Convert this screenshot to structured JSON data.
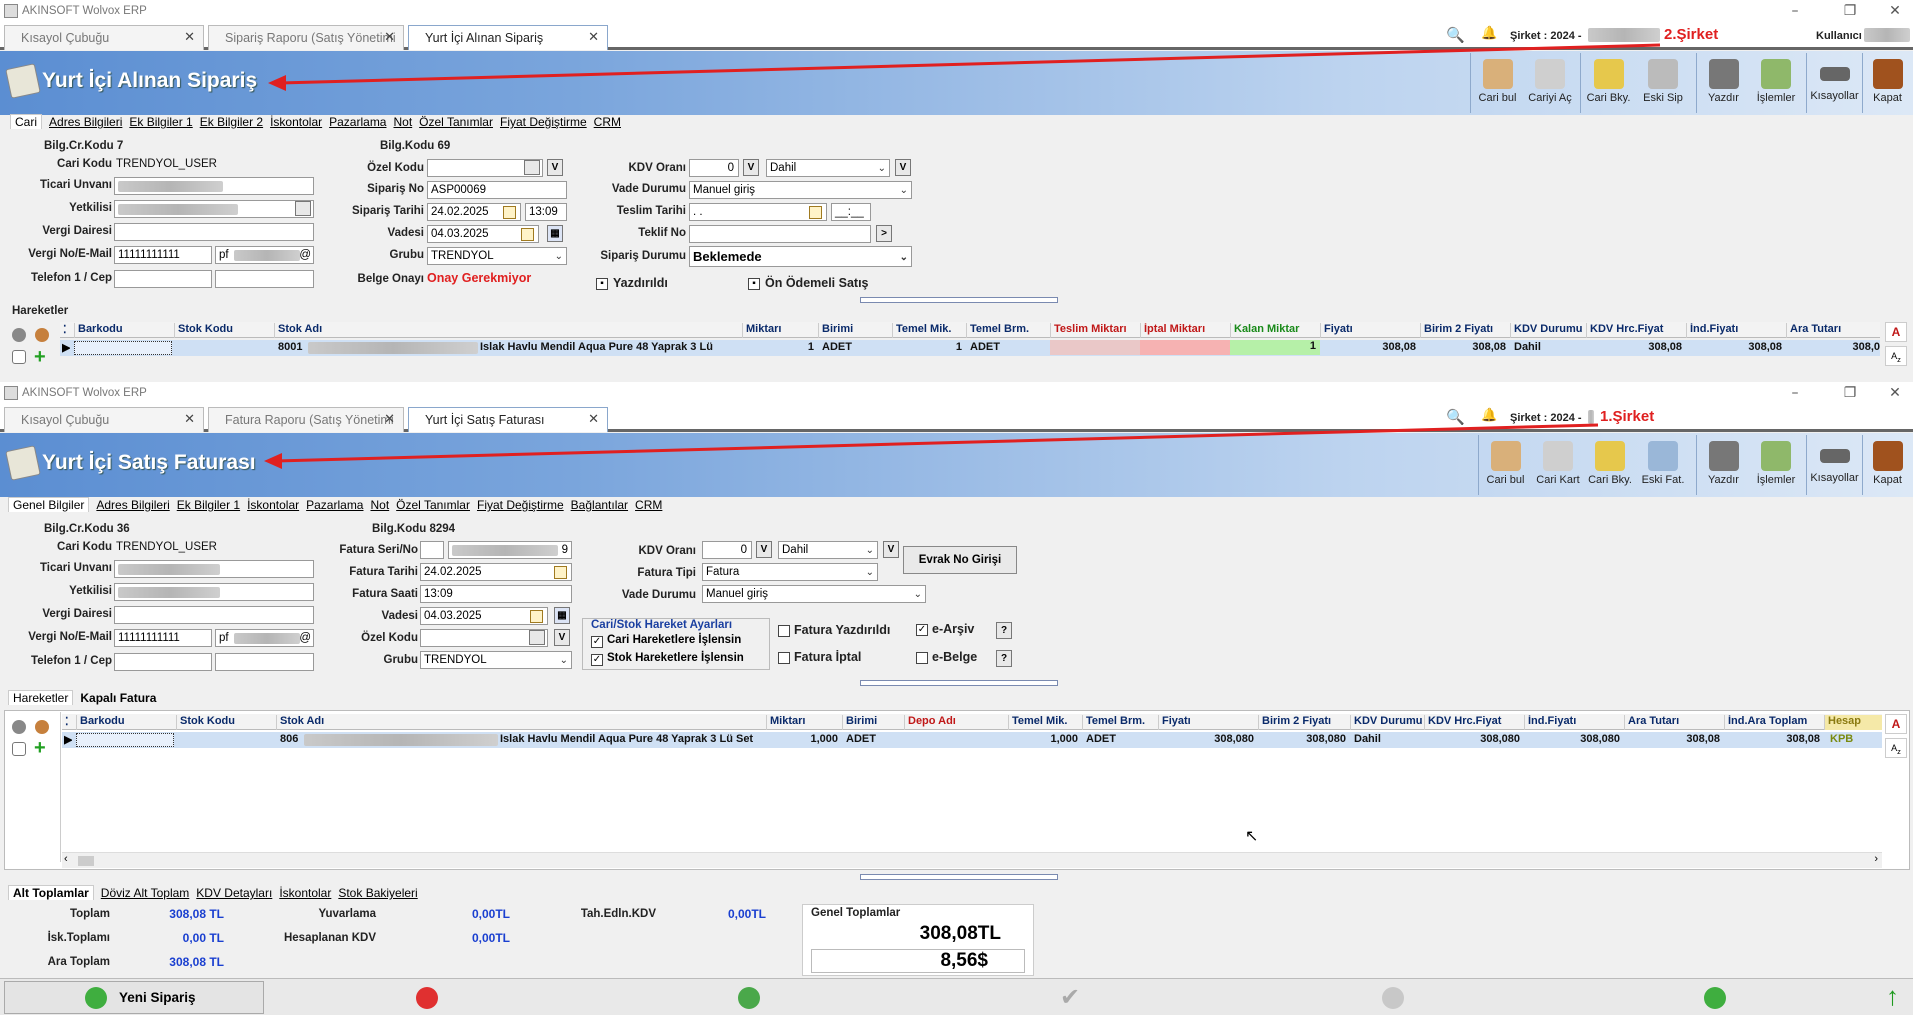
{
  "top": {
    "app_title": "AKINSOFT Wolvox ERP",
    "tabs": [
      {
        "label": "Kısayol Çubuğu"
      },
      {
        "label": "Sipariş Raporu (Satış Yönetimi"
      },
      {
        "label": "Yurt İçi Alınan Sipariş"
      }
    ],
    "sirket": "Şirket : 2024 -",
    "sirket_tag": "2.Şirket",
    "kullanici": "Kullanıcı",
    "page_title": "Yurt İçi Alınan Sipariş",
    "toolbar": [
      "Cari bul",
      "Cariyi Aç",
      "Cari Bky.",
      "Eski Sip",
      "Yazdır",
      "İşlemler",
      "Kısayollar",
      "Kapat"
    ],
    "form_tabs": [
      "Cari",
      "Adres Bilgileri",
      "Ek Bilgiler 1",
      "Ek Bilgiler 2",
      "İskontolar",
      "Pazarlama",
      "Not",
      "Özel Tanımlar",
      "Fiyat Değiştirme",
      "CRM"
    ],
    "bilg_cr_kodu": "Bilg.Cr.Kodu 7",
    "cari_kodu_label": "Cari Kodu",
    "cari_kodu": "TRENDYOL_USER",
    "ticari_unvani": "Ticari Unvanı",
    "yetkilisi": "Yetkilisi",
    "vergi_dairesi": "Vergi Dairesi",
    "vergi_no_label": "Vergi No/E-Mail",
    "vergi_no": "11111111111",
    "email_prefix": "pf",
    "email_suffix": "@",
    "telefon": "Telefon 1 / Cep",
    "bilg_kodu": "Bilg.Kodu 69",
    "ozel_kodu": "Özel Kodu",
    "siparis_no_label": "Sipariş No",
    "siparis_no": "ASP00069",
    "siparis_tarihi_label": "Sipariş Tarihi",
    "siparis_tarihi": "24.02.2025",
    "siparis_saati": "13:09",
    "vadesi_label": "Vadesi",
    "vadesi": "04.03.2025",
    "grubu_label": "Grubu",
    "grubu": "TRENDYOL",
    "belge_onayi_label": "Belge Onayı",
    "belge_onayi": "Onay Gerekmiyor",
    "kdv_orani_label": "KDV Oranı",
    "kdv_orani": "0",
    "kdv_dahil": "Dahil",
    "v": "V",
    "vade_durumu_label": "Vade Durumu",
    "vade_durumu": "Manuel giriş",
    "teslim_tarihi_label": "Teslim Tarihi",
    "teslim_tarihi": ". .",
    "teslim_saati": "__:__",
    "teklif_no_label": "Teklif No",
    "teklif_btn": ">",
    "siparis_durumu_label": "Sipariş Durumu",
    "siparis_durumu": "Beklemede",
    "yazdirildi": "Yazdırıldı",
    "on_odemeli": "Ön Ödemeli Satış",
    "hareketler": "Hareketler",
    "columns": [
      "Barkodu",
      "Stok Kodu",
      "Stok Adı",
      "Miktarı",
      "Birimi",
      "Temel Mik.",
      "Temel Brm.",
      "Teslim Miktarı",
      "İptal Miktarı",
      "Kalan Miktar",
      "Fiyatı",
      "Birim 2 Fiyatı",
      "KDV Durumu",
      "KDV Hrc.Fiyat",
      "İnd.Fiyatı",
      "Ara Tutarı"
    ],
    "row": {
      "stok_kodu_prefix": "8001",
      "stok_adi": "Islak Havlu Mendil Aqua Pure 48 Yaprak 3 Lü",
      "miktar": "1",
      "birimi": "ADET",
      "temel_mik": "1",
      "temel_brm": "ADET",
      "kalan": "1",
      "fiyati": "308,08",
      "birim2": "308,08",
      "kdv": "Dahil",
      "kdv_hrc": "308,08",
      "ind": "308,08",
      "ara": "308,0"
    }
  },
  "bottom": {
    "app_title": "AKINSOFT Wolvox ERP",
    "tabs": [
      {
        "label": "Kısayol Çubuğu"
      },
      {
        "label": "Fatura Raporu (Satış Yönetimi"
      },
      {
        "label": "Yurt İçi Satış Faturası"
      }
    ],
    "sirket": "Şirket : 2024 -",
    "sirket_tag": "1.Şirket",
    "page_title": "Yurt İçi Satış Faturası",
    "toolbar": [
      "Cari bul",
      "Cari Kart",
      "Cari Bky.",
      "Eski Fat.",
      "Yazdır",
      "İşlemler",
      "Kısayollar",
      "Kapat"
    ],
    "form_tabs": [
      "Genel Bilgiler",
      "Adres Bilgileri",
      "Ek Bilgiler 1",
      "İskontolar",
      "Pazarlama",
      "Not",
      "Özel Tanımlar",
      "Fiyat Değiştirme",
      "Bağlantılar",
      "CRM"
    ],
    "bilg_cr_kodu": "Bilg.Cr.Kodu 36",
    "cari_kodu_label": "Cari Kodu",
    "cari_kodu": "TRENDYOL_USER",
    "ticari_unvani": "Ticari Unvanı",
    "yetkilisi": "Yetkilisi",
    "vergi_dairesi": "Vergi Dairesi",
    "vergi_no_label": "Vergi No/E-Mail",
    "vergi_no": "11111111111",
    "email_prefix": "pf",
    "email_suffix": "@",
    "telefon": "Telefon 1 / Cep",
    "bilg_kodu": "Bilg.Kodu 8294",
    "fatura_seri_label": "Fatura Seri/No",
    "fatura_no_suffix": "9",
    "fatura_tarihi_label": "Fatura Tarihi",
    "fatura_tarihi": "24.02.2025",
    "fatura_saati_label": "Fatura Saati",
    "fatura_saati": "13:09",
    "vadesi_label": "Vadesi",
    "vadesi": "04.03.2025",
    "ozel_kodu": "Özel Kodu",
    "grubu_label": "Grubu",
    "grubu": "TRENDYOL",
    "kdv_orani_label": "KDV Oranı",
    "kdv_orani": "0",
    "kdv_dahil": "Dahil",
    "v": "V",
    "evrak_btn": "Evrak No Girişi",
    "fatura_tipi_label": "Fatura Tipi",
    "fatura_tipi": "Fatura",
    "vade_durumu_label": "Vade Durumu",
    "vade_durumu": "Manuel giriş",
    "ayarlar_title": "Cari/Stok Hareket Ayarları",
    "cari_hareket": "Cari Hareketlere İşlensin",
    "stok_hareket": "Stok Hareketlere İşlensin",
    "fatura_yazdirildi": "Fatura Yazdırıldı",
    "fatura_iptal": "Fatura İptal",
    "e_arsiv": "e-Arşiv",
    "e_belge": "e-Belge",
    "q": "?",
    "hareket_tabs": [
      "Hareketler",
      "Kapalı Fatura"
    ],
    "columns": [
      "Barkodu",
      "Stok Kodu",
      "Stok Adı",
      "Miktarı",
      "Birimi",
      "Depo Adı",
      "Temel Mik.",
      "Temel Brm.",
      "Fiyatı",
      "Birim 2 Fiyatı",
      "KDV Durumu",
      "KDV Hrc.Fiyat",
      "İnd.Fiyatı",
      "Ara Tutarı",
      "İnd.Ara Toplam",
      "Hesap"
    ],
    "row": {
      "stok_kodu_prefix": "806",
      "stok_adi": "Islak Havlu Mendil Aqua Pure 48 Yaprak 3 Lü Set",
      "miktar": "1,000",
      "birimi": "ADET",
      "temel_mik": "1,000",
      "temel_brm": "ADET",
      "fiyati": "308,080",
      "birim2": "308,080",
      "kdv": "Dahil",
      "kdv_hrc": "308,080",
      "ind": "308,080",
      "ara": "308,08",
      "ind_ara": "308,08",
      "hesap": "KPB"
    },
    "total_tabs": [
      "Alt Toplamlar",
      "Döviz Alt Toplam",
      "KDV Detayları",
      "İskontolar",
      "Stok Bakiyeleri"
    ],
    "toplam_label": "Toplam",
    "toplam": "308,08 TL",
    "isk_label": "İsk.Toplamı",
    "isk": "0,00 TL",
    "ara_label": "Ara Toplam",
    "ara": "308,08 TL",
    "yuvarlama_label": "Yuvarlama",
    "yuvarlama": "0,00TL",
    "hesaplanan_label": "Hesaplanan KDV",
    "hesaplanan": "0,00TL",
    "tah_label": "Tah.Edln.KDV",
    "tah": "0,00TL",
    "genel_label": "Genel Toplamlar",
    "genel_tl": "308,08TL",
    "genel_usd": "8,56$",
    "yeni_siparis": "Yeni Sipariş"
  },
  "colors": {
    "accent_red": "#e02020",
    "banner_blue": "#5b8ed2",
    "total_blue": "#1a3fd0"
  }
}
